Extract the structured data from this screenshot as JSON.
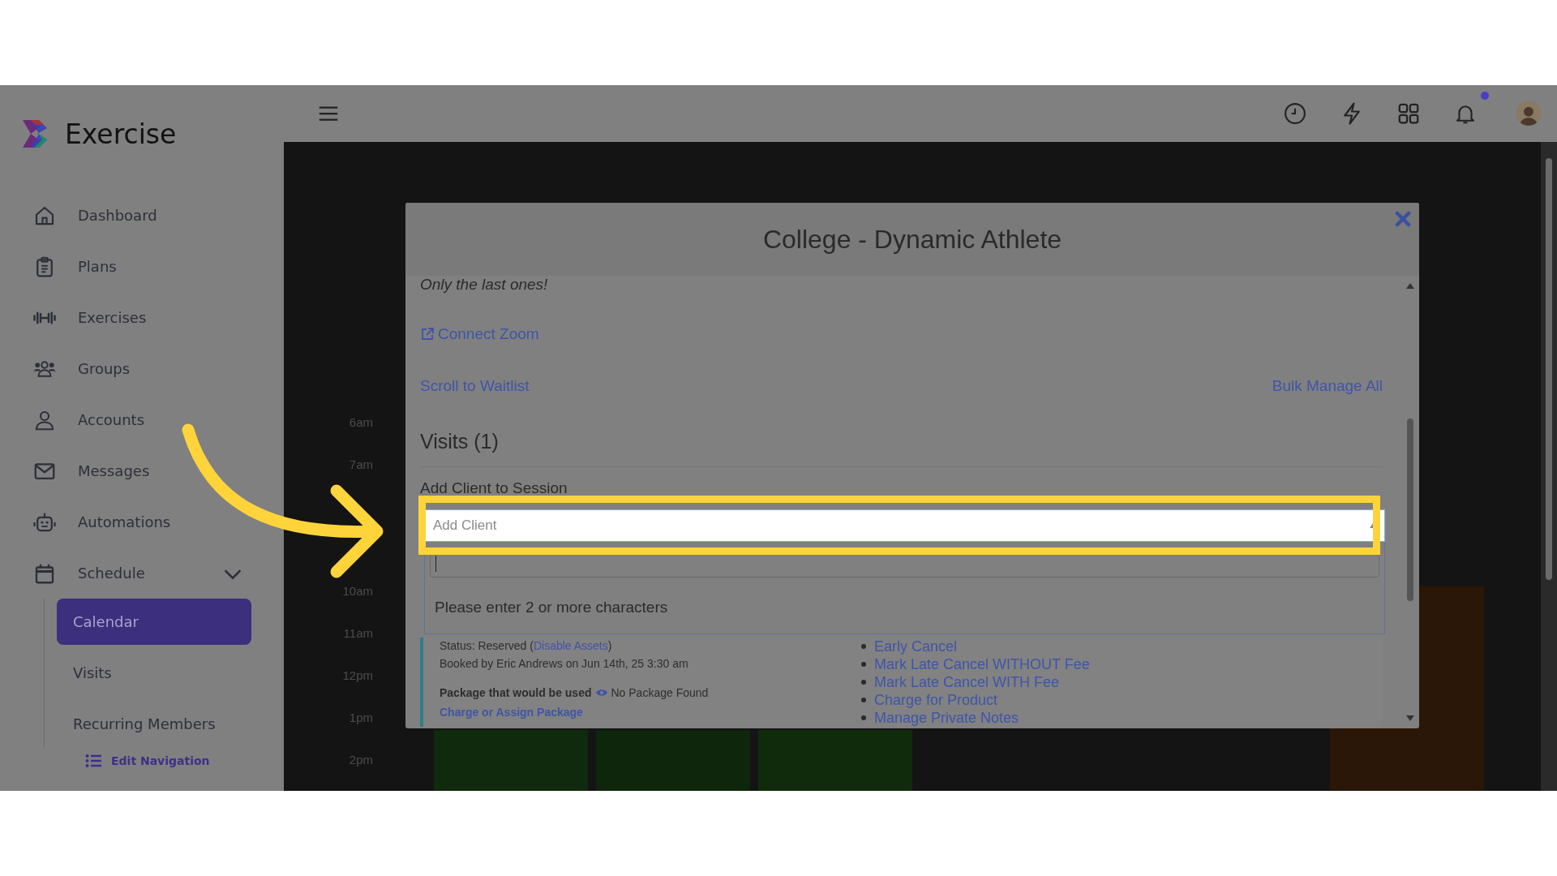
{
  "app": {
    "logo": "Exercise"
  },
  "sidebar": {
    "items": [
      {
        "label": "Dashboard",
        "kind": "home"
      },
      {
        "label": "Plans",
        "kind": "clipboard"
      },
      {
        "label": "Exercises",
        "kind": "dumbbell"
      },
      {
        "label": "Groups",
        "kind": "people"
      },
      {
        "label": "Accounts",
        "kind": "person"
      },
      {
        "label": "Messages",
        "kind": "envelope"
      },
      {
        "label": "Automations",
        "kind": "robot"
      },
      {
        "label": "Schedule",
        "kind": "calendar",
        "expanded": true,
        "children": [
          {
            "label": "Calendar",
            "selected": true
          },
          {
            "label": "Visits",
            "selected": false
          },
          {
            "label": "Recurring Members",
            "selected": false
          }
        ]
      }
    ],
    "edit_link": "Edit Navigation"
  },
  "topbar": {
    "notification_dot": true
  },
  "calendar_background": {
    "time_labels": [
      "6am",
      "7am",
      "10am",
      "11am",
      "12pm",
      "1pm",
      "2pm"
    ]
  },
  "modal": {
    "title": "College - Dynamic Athlete",
    "note": "Only the last ones!",
    "connect_link": "Connect Zoom",
    "scroll_link": "Scroll to Waitlist",
    "bulk_link": "Bulk Manage All",
    "visits_heading": "Visits (1)",
    "add_label": "Add Client to Session",
    "select": {
      "placeholder": "Add Client",
      "expanded": true
    },
    "dropdown": {
      "message": "Please enter 2 or more characters"
    },
    "visit": {
      "status": "Status: Reserved (",
      "status_link": "Disable Assets",
      "status_end": ")",
      "booked": "Booked by Eric Andrews on Jun 14th, 25 3:30 am",
      "package_label": "Package that would be used",
      "package_value": "No Package Found",
      "package_link": "Charge or Assign Package",
      "actions": [
        "Early Cancel",
        "Mark Late Cancel WITHOUT Fee",
        "Mark Late Cancel WITH Fee",
        "Charge for Product",
        "Manage Private Notes"
      ]
    }
  }
}
